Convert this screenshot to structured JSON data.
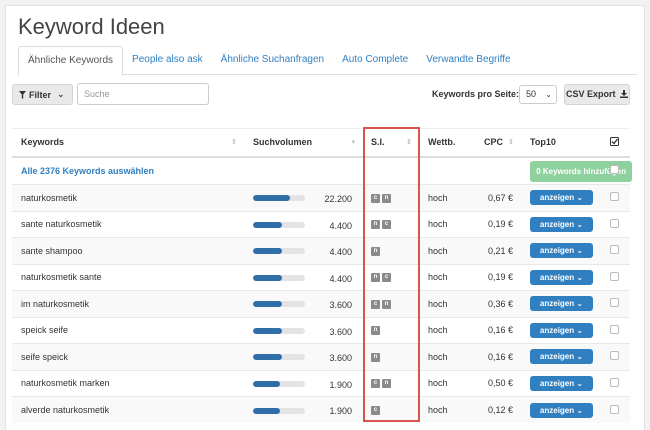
{
  "page": {
    "title": "Keyword Ideen"
  },
  "tabs": [
    {
      "label": "Ähnliche Keywords",
      "active": true
    },
    {
      "label": "People also ask",
      "active": false
    },
    {
      "label": "Ähnliche Suchanfragen",
      "active": false
    },
    {
      "label": "Auto Complete",
      "active": false
    },
    {
      "label": "Verwandte Begriffe",
      "active": false
    }
  ],
  "toolbar": {
    "filter_label": "Filter",
    "search_placeholder": "Suche",
    "per_page_label": "Keywords pro Seite:",
    "per_page_value": "50",
    "csv_label": "CSV Export"
  },
  "table": {
    "headers": {
      "keywords": "Keywords",
      "volume": "Suchvolumen",
      "si": "S.I.",
      "competition": "Wettb.",
      "cpc": "CPC",
      "top10": "Top10"
    },
    "select_all": "Alle 2376 Keywords auswählen",
    "add_button": "0 Keywords hinzufügen",
    "show_button": "anzeigen",
    "rows": [
      {
        "keyword": "naturkosmetik",
        "volume": "22.200",
        "fill": 0.72,
        "si": [
          "c",
          "n"
        ],
        "competition": "hoch",
        "cpc": "0,67 €"
      },
      {
        "keyword": "sante naturkosmetik",
        "volume": "4.400",
        "fill": 0.56,
        "si": [
          "n",
          "c"
        ],
        "competition": "hoch",
        "cpc": "0,19 €"
      },
      {
        "keyword": "sante shampoo",
        "volume": "4.400",
        "fill": 0.56,
        "si": [
          "n"
        ],
        "competition": "hoch",
        "cpc": "0,21 €"
      },
      {
        "keyword": "naturkosmetik sante",
        "volume": "4.400",
        "fill": 0.56,
        "si": [
          "n",
          "c"
        ],
        "competition": "hoch",
        "cpc": "0,19 €"
      },
      {
        "keyword": "im naturkosmetik",
        "volume": "3.600",
        "fill": 0.55,
        "si": [
          "c",
          "n"
        ],
        "competition": "hoch",
        "cpc": "0,36 €"
      },
      {
        "keyword": "speick seife",
        "volume": "3.600",
        "fill": 0.55,
        "si": [
          "n"
        ],
        "competition": "hoch",
        "cpc": "0,16 €"
      },
      {
        "keyword": "seife speick",
        "volume": "3.600",
        "fill": 0.55,
        "si": [
          "n"
        ],
        "competition": "hoch",
        "cpc": "0,16 €"
      },
      {
        "keyword": "naturkosmetik marken",
        "volume": "1.900",
        "fill": 0.52,
        "si": [
          "c",
          "n"
        ],
        "competition": "hoch",
        "cpc": "0,50 €"
      },
      {
        "keyword": "alverde naturkosmetik",
        "volume": "1.900",
        "fill": 0.52,
        "si": [
          "c"
        ],
        "competition": "hoch",
        "cpc": "0,12 €"
      }
    ]
  },
  "colors": {
    "accent": "#2f7fc1",
    "highlight": "#d9534f",
    "add_button": "#8fd19e"
  }
}
